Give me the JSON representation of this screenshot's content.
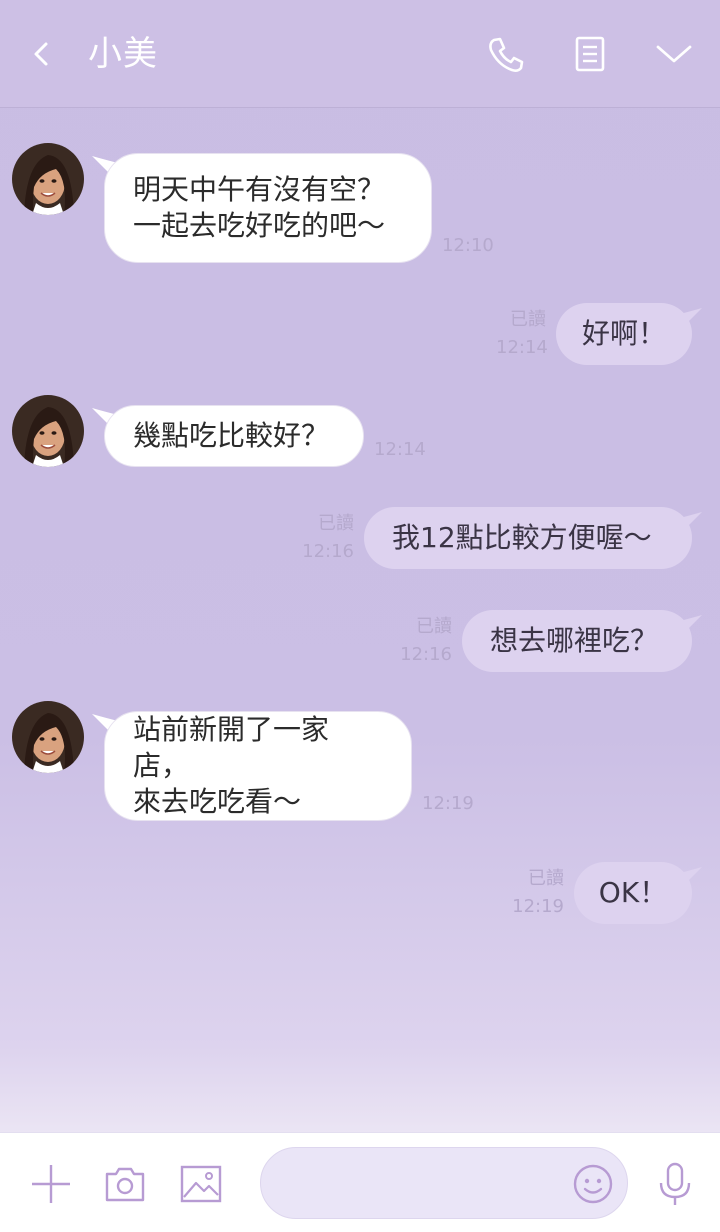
{
  "header": {
    "title": "小美"
  },
  "messages": [
    {
      "side": "in",
      "lines": [
        "明天中午有沒有空？",
        "一起去吃好吃的吧～"
      ],
      "time": "12:10"
    },
    {
      "side": "out",
      "text": "好啊！",
      "read": "已讀",
      "time": "12:14"
    },
    {
      "side": "in",
      "lines": [
        "幾點吃比較好？"
      ],
      "time": "12:14"
    },
    {
      "side": "out",
      "text": "我12點比較方便喔～",
      "read": "已讀",
      "time": "12:16"
    },
    {
      "side": "out",
      "text": "想去哪裡吃？",
      "read": "已讀",
      "time": "12:16"
    },
    {
      "side": "in",
      "lines": [
        "站前新開了一家店，",
        "來去吃吃看～"
      ],
      "time": "12:19"
    },
    {
      "side": "out",
      "text": "OK！",
      "read": "已讀",
      "time": "12:19"
    }
  ],
  "colors": {
    "header": "#cdc0e5",
    "background": "#c9bde3",
    "incoming_bubble": "#ffffff",
    "outgoing_bubble": "#ddd2ef",
    "icon_accent": "#b79bd3"
  },
  "icons": {
    "header": [
      "back-chevron-icon",
      "phone-icon",
      "notes-icon",
      "chevron-down-icon"
    ],
    "bottom": [
      "plus-icon",
      "camera-icon",
      "image-icon",
      "emoji-icon",
      "microphone-icon"
    ]
  }
}
